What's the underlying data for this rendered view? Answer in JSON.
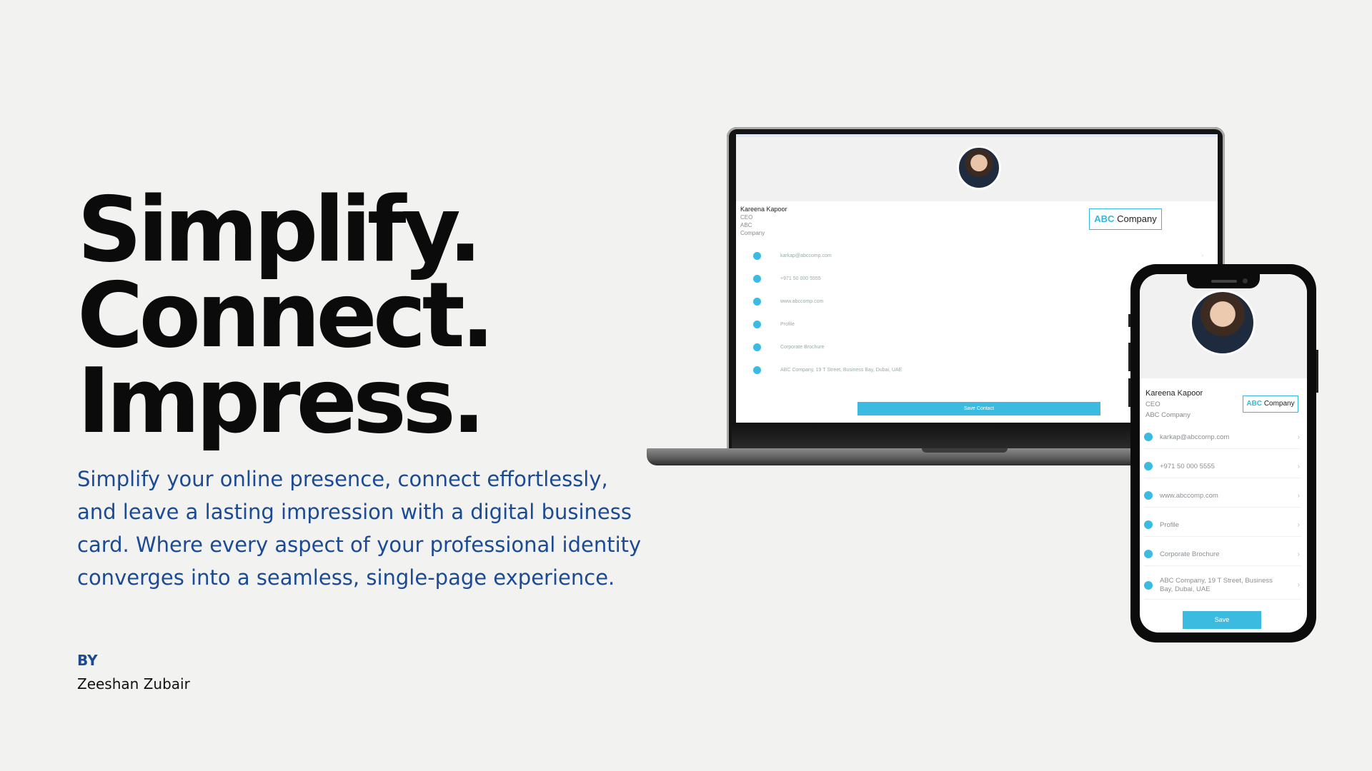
{
  "hero": {
    "headline": [
      "Simplify.",
      "Connect.",
      "Impress."
    ],
    "tagline": "Simplify your online presence, connect effortlessly, and leave a lasting impression with a digital business card. Where every aspect of your professional identity converges into a seamless, single-page experience.",
    "by_label": "BY",
    "author": "Zeeshan Zubair"
  },
  "laptop_card": {
    "name": "Kareena Kapoor",
    "title": "CEO",
    "company_lines": [
      "ABC",
      "Company"
    ],
    "logo": {
      "accent": "ABC",
      "rest": "Company"
    },
    "rows": [
      "karkap@abccomp.com",
      "+971 50 000 5555",
      "www.abccomp.com",
      "Profile",
      "Corporate Brochure",
      "ABC Company, 19 T Street, Business Bay, Dubai, UAE"
    ],
    "save_label": "Save Contact"
  },
  "phone_card": {
    "name": "Kareena Kapoor",
    "title": "CEO",
    "company": "ABC Company",
    "logo": {
      "accent": "ABC",
      "rest": "Company"
    },
    "rows": [
      "karkap@abccomp.com",
      "+971 50 000 5555",
      "www.abccomp.com",
      "Profile",
      "Corporate Brochure",
      "ABC Company, 19 T Street, Business Bay, Dubai, UAE"
    ],
    "save_label": "Save"
  },
  "colors": {
    "background": "#f2f2f1",
    "headline": "#0b0b0b",
    "tagline": "#1c4a93",
    "accent": "#3cbbe0"
  },
  "icons": [
    "email-icon",
    "phone-icon",
    "web-icon",
    "profile-icon",
    "brochure-icon",
    "location-icon",
    "chevron-right-icon"
  ]
}
